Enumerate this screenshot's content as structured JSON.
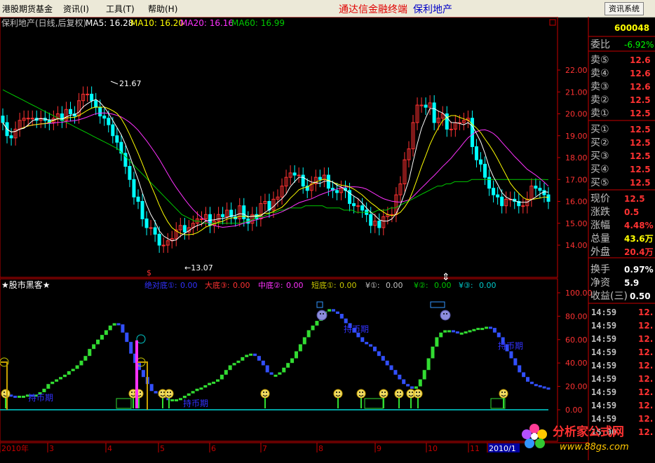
{
  "menubar": {
    "items": [
      "港股期货基金",
      "资讯(I)",
      "工具(T)",
      "帮助(H)"
    ],
    "app_title": "通达信金融终端",
    "stock_name": "保利地产",
    "sys_button": "资讯系统"
  },
  "chart_header": {
    "name": "保利地产(日线,后复权)",
    "ma5": "MA5: 16.28",
    "ma10": "MA10: 16.20",
    "ma20": "MA20: 16.16",
    "ma60": "MA60: 16.99"
  },
  "price_axis": {
    "ticks": [
      "22.00",
      "21.00",
      "20.00",
      "19.00",
      "18.00",
      "17.00",
      "16.00",
      "15.00",
      "14.00"
    ]
  },
  "price_annotations": {
    "high": "21.67",
    "low": "13.07",
    "marker": "$"
  },
  "indicator_header": {
    "title": "★股市黑客★",
    "items": [
      {
        "label": "绝对底①:",
        "value": "0.00",
        "color": "#3232FF"
      },
      {
        "label": "大底③:",
        "value": "0.00",
        "color": "#FF3232"
      },
      {
        "label": "中底②:",
        "value": "0.00",
        "color": "#FF32FF"
      },
      {
        "label": "短底①:",
        "value": "0.00",
        "color": "#C8C800"
      },
      {
        "label": "¥①:",
        "value": "0.00",
        "color": "#C0C0C0"
      },
      {
        "label": "¥②:",
        "value": "0.00",
        "color": "#00C800"
      },
      {
        "label": "¥③:",
        "value": "0.00",
        "color": "#00C8C8"
      }
    ]
  },
  "indicator_axis": {
    "ticks": [
      "100.00",
      "80.00",
      "60.00",
      "40.00",
      "20.00",
      "0.00"
    ]
  },
  "indicator_labels": {
    "bear1": "持币期",
    "bear2": "持币期",
    "bear3": "持币期",
    "bear4": "持币期"
  },
  "time_axis": {
    "labels": [
      "2010年",
      "3",
      "4",
      "5",
      "6",
      "7",
      "8",
      "9",
      "10",
      "11",
      "2010/1"
    ]
  },
  "quote_panel": {
    "code": "600048",
    "ratio_label": "委比",
    "ratio_value": "-6.92%",
    "asks": [
      {
        "label": "卖⑤",
        "price": "12.6"
      },
      {
        "label": "卖④",
        "price": "12.6"
      },
      {
        "label": "卖③",
        "price": "12.6"
      },
      {
        "label": "卖②",
        "price": "12.5"
      },
      {
        "label": "卖①",
        "price": "12.5"
      }
    ],
    "bids": [
      {
        "label": "买①",
        "price": "12.5"
      },
      {
        "label": "买②",
        "price": "12.5"
      },
      {
        "label": "买③",
        "price": "12.5"
      },
      {
        "label": "买④",
        "price": "12.5"
      },
      {
        "label": "买⑤",
        "price": "12.5"
      }
    ],
    "stats": [
      {
        "label": "现价",
        "value": "12.5",
        "color": "#FF3232"
      },
      {
        "label": "涨跌",
        "value": "0.5",
        "color": "#FF3232"
      },
      {
        "label": "涨幅",
        "value": "4.48%",
        "color": "#FF3232"
      },
      {
        "label": "总量",
        "value": "43.6万",
        "color": "#FFFF00"
      },
      {
        "label": "外盘",
        "value": "20.4万",
        "color": "#FF3232"
      },
      {
        "label": "换手",
        "value": "0.97%",
        "color": "#FFFFFF"
      },
      {
        "label": "净资",
        "value": "5.9",
        "color": "#FFFFFF"
      },
      {
        "label": "收益(三)",
        "value": "0.50",
        "color": "#FFFFFF"
      }
    ],
    "ticks": [
      {
        "time": "14:59",
        "price": "12.",
        "color": "#FF3232"
      },
      {
        "time": "14:59",
        "price": "12.",
        "color": "#FF3232"
      },
      {
        "time": "14:59",
        "price": "12.",
        "color": "#FF3232"
      },
      {
        "time": "14:59",
        "price": "12.",
        "color": "#FF3232"
      },
      {
        "time": "14:59",
        "price": "12.",
        "color": "#FF3232"
      },
      {
        "time": "14:59",
        "price": "12.",
        "color": "#FF3232"
      },
      {
        "time": "14:59",
        "price": "12.",
        "color": "#FF3232"
      },
      {
        "time": "14:59",
        "price": "12.",
        "color": "#FF3232"
      },
      {
        "time": "14:59",
        "price": "12.",
        "color": "#FF3232"
      },
      {
        "time": "15:00",
        "price": "12.",
        "color": "#FF3232"
      }
    ]
  },
  "watermark": {
    "text": "分析家公式网",
    "url": "www.88gs.com"
  },
  "colors": {
    "up": "#FF3232",
    "down": "#00FFFF",
    "ma5": "#FFFFFF",
    "ma10": "#FFFF00",
    "ma20": "#FF32FF",
    "ma60": "#00C800",
    "grid": "#800000",
    "axis": "#C80000"
  },
  "chart_data": {
    "type": "candlestick",
    "ylim": [
      13.0,
      22.5
    ],
    "close": [
      19.6,
      19.0,
      18.9,
      19.3,
      19.7,
      19.8,
      19.8,
      19.8,
      19.7,
      19.8,
      19.7,
      19.6,
      19.8,
      20.0,
      19.7,
      20.2,
      20.0,
      19.9,
      20.6,
      20.9,
      20.9,
      20.6,
      20.3,
      19.9,
      19.8,
      19.5,
      19.0,
      18.7,
      18.2,
      17.6,
      17.0,
      16.2,
      16.0,
      15.2,
      14.8,
      14.8,
      14.5,
      14.0,
      14.0,
      14.2,
      14.3,
      14.7,
      14.9,
      14.6,
      14.8,
      15.0,
      15.2,
      15.2,
      15.4,
      14.9,
      15.1,
      15.4,
      15.3,
      15.6,
      15.3,
      15.2,
      15.8,
      15.2,
      15.0,
      15.4,
      15.2,
      15.9,
      16.0,
      15.6,
      16.1,
      16.2,
      16.7,
      17.1,
      17.3,
      17.2,
      17.2,
      16.7,
      16.5,
      16.8,
      17.1,
      17.0,
      17.2,
      16.6,
      16.5,
      16.4,
      16.6,
      16.5,
      15.9,
      15.8,
      15.8,
      15.6,
      15.4,
      14.9,
      15.1,
      14.8,
      15.3,
      15.4,
      15.4,
      16.3,
      16.8,
      17.9,
      18.4,
      19.6,
      20.4,
      20.4,
      20.3,
      20.5,
      19.6,
      19.8,
      20.0,
      19.3,
      19.3,
      19.6,
      19.6,
      19.7,
      19.8,
      18.5,
      17.9,
      17.7,
      17.1,
      16.6,
      16.3,
      16.2,
      15.8,
      16.1,
      16.1,
      16.0,
      15.8,
      15.8,
      16.1,
      16.7,
      16.6,
      16.5,
      16.3,
      16.0
    ],
    "ma60": [
      21.1,
      21.0,
      20.9,
      20.8,
      20.7,
      20.6,
      20.5,
      20.4,
      20.3,
      20.2,
      20.1,
      20.0,
      19.9,
      19.8,
      19.7,
      19.6,
      19.5,
      19.4,
      19.3,
      19.2,
      19.1,
      19.0,
      18.9,
      18.8,
      18.7,
      18.6,
      18.5,
      18.4,
      18.2,
      18.0,
      17.8,
      17.6,
      17.4,
      17.2,
      17.0,
      16.8,
      16.6,
      16.4,
      16.2,
      16.0,
      15.8,
      15.6,
      15.4,
      15.3,
      15.2,
      15.1,
      15.1,
      15.0,
      15.0,
      15.0,
      15.0,
      15.0,
      15.0,
      15.0,
      15.0,
      15.0,
      15.0,
      15.1,
      15.1,
      15.2,
      15.3,
      15.3,
      15.4,
      15.5,
      15.5,
      15.6,
      15.6,
      15.7,
      15.7,
      15.7,
      15.7,
      15.8,
      15.8,
      15.8,
      15.8,
      15.8,
      15.7,
      15.7,
      15.7,
      15.7,
      15.6,
      15.6,
      15.6,
      15.5,
      15.5,
      15.5,
      15.5,
      15.5,
      15.6,
      15.6,
      15.6,
      15.7,
      15.7,
      15.8,
      15.9,
      16.0,
      16.1,
      16.2,
      16.3,
      16.4,
      16.5,
      16.6,
      16.7,
      16.7,
      16.8,
      16.8,
      16.9,
      16.9,
      16.9,
      16.9,
      17.0,
      17.0,
      17.0,
      17.0,
      17.0,
      17.0,
      17.0,
      17.0,
      17.0,
      17.0,
      17.0,
      17.0,
      17.0,
      17.0,
      17.0,
      17.0,
      17.0,
      17.0,
      16.99
    ],
    "indicator": [
      14,
      13,
      12,
      11,
      12,
      12,
      13,
      12,
      13,
      15,
      18,
      22,
      24,
      26,
      28,
      30,
      33,
      35,
      38,
      42,
      46,
      52,
      56,
      60,
      64,
      68,
      72,
      74,
      73,
      66,
      58,
      48,
      40,
      34,
      28,
      22,
      16,
      14,
      12,
      10,
      9,
      9,
      9,
      10,
      12,
      14,
      16,
      18,
      19,
      21,
      23,
      24,
      26,
      30,
      34,
      38,
      40,
      42,
      45,
      47,
      48,
      46,
      42,
      38,
      32,
      30,
      30,
      32,
      36,
      40,
      44,
      50,
      56,
      62,
      68,
      72,
      76,
      80,
      84,
      86,
      84,
      82,
      78,
      74,
      70,
      66,
      62,
      58,
      56,
      54,
      50,
      46,
      42,
      38,
      34,
      30,
      26,
      22,
      20,
      18,
      20,
      26,
      34,
      44,
      54,
      62,
      66,
      68,
      68,
      67,
      66,
      66,
      67,
      68,
      69,
      70,
      70,
      71,
      70,
      66,
      62,
      56,
      50,
      44,
      38,
      32,
      28,
      24,
      22,
      21,
      20,
      19,
      18
    ]
  }
}
